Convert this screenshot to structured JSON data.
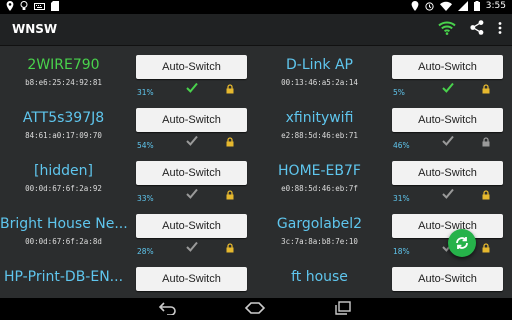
{
  "status_bar": {
    "left_icons": [
      "location-pin-icon",
      "bulb-icon",
      "keyboard-icon",
      "sd-card-icon"
    ],
    "right_icons": [
      "location-icon",
      "alarm-icon",
      "wifi-icon",
      "signal-icon",
      "battery-icon"
    ],
    "time": "3:55"
  },
  "app": {
    "title": "WNSW",
    "actions": [
      "wifi-icon",
      "share-icon",
      "overflow-menu-icon"
    ],
    "accent_wifi_color": "#49d24c"
  },
  "networks": [
    {
      "ssid": "2WIRE790",
      "bssid": "b8:e6:25:24:92:81",
      "signal": "31%",
      "button": "Auto-Switch",
      "active": true,
      "check": "green",
      "lock": "yellow"
    },
    {
      "ssid": "D-Link AP",
      "bssid": "00:13:46:a5:2a:14",
      "signal": "5%",
      "button": "Auto-Switch",
      "active": false,
      "check": "green",
      "lock": "yellow"
    },
    {
      "ssid": "ATT5s397J8",
      "bssid": "84:61:a0:17:09:70",
      "signal": "54%",
      "button": "Auto-Switch",
      "active": false,
      "check": "gray",
      "lock": "yellow"
    },
    {
      "ssid": "xfinitywifi",
      "bssid": "e2:88:5d:46:eb:71",
      "signal": "46%",
      "button": "Auto-Switch",
      "active": false,
      "check": "gray",
      "lock": "gray"
    },
    {
      "ssid": "[hidden]",
      "bssid": "00:0d:67:6f:2a:92",
      "signal": "33%",
      "button": "Auto-Switch",
      "active": false,
      "check": "gray",
      "lock": "yellow"
    },
    {
      "ssid": "HOME-EB7F",
      "bssid": "e0:88:5d:46:eb:7f",
      "signal": "31%",
      "button": "Auto-Switch",
      "active": false,
      "check": "gray",
      "lock": "yellow"
    },
    {
      "ssid": "Bright House Ne...",
      "bssid": "00:0d:67:6f:2a:8d",
      "signal": "28%",
      "button": "Auto-Switch",
      "active": false,
      "check": "gray",
      "lock": "yellow"
    },
    {
      "ssid": "Gargolabel2",
      "bssid": "3c:7a:8a:b8:7e:10",
      "signal": "18%",
      "button": "Auto-Switch",
      "active": false,
      "check": "gray",
      "lock": "yellow"
    },
    {
      "ssid": "HP-Print-DB-EN...",
      "bssid": "",
      "signal": "",
      "button": "Auto-Switch",
      "active": false,
      "check": "none",
      "lock": "none"
    },
    {
      "ssid": "ft house",
      "bssid": "",
      "signal": "",
      "button": "Auto-Switch",
      "active": false,
      "check": "none",
      "lock": "none"
    }
  ],
  "colors": {
    "ssid": "#5fc6ee",
    "ssid_active": "#49d24c",
    "check_green": "#49d24c",
    "check_gray": "#9a9a9a",
    "lock_yellow": "#e6b82e",
    "lock_gray": "#9a9a9a",
    "fab": "#26b24a"
  },
  "nav_bar": [
    "back-icon",
    "home-icon",
    "recents-icon"
  ],
  "fab_icon": "refresh-icon"
}
